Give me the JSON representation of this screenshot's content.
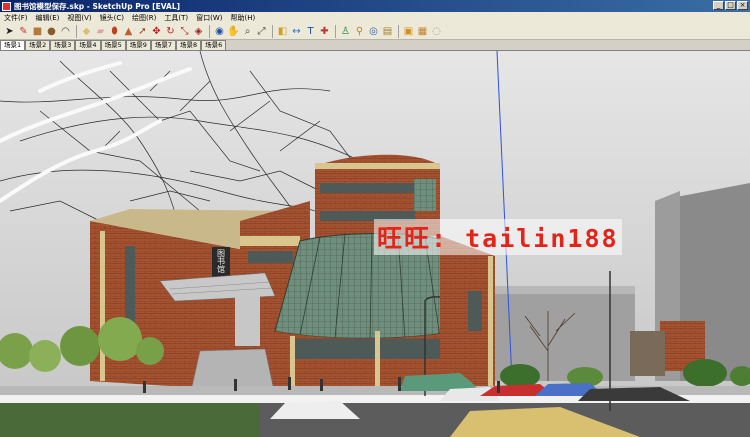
{
  "window": {
    "title": "图书馆模型保存.skp - SketchUp Pro [EVAL]"
  },
  "menu": [
    "文件(F)",
    "编辑(E)",
    "视图(V)",
    "镜头(C)",
    "绘图(R)",
    "工具(T)",
    "窗口(W)",
    "帮助(H)"
  ],
  "toolbar": {
    "tools": [
      {
        "name": "select-icon",
        "color": "#222"
      },
      {
        "name": "pencil-icon",
        "color": "#c0392b"
      },
      {
        "name": "rectangle-icon",
        "color": "#b07a3a"
      },
      {
        "name": "circle-icon",
        "color": "#8a5a2a"
      },
      {
        "name": "arc-icon",
        "color": "#444"
      },
      {
        "name": "sep"
      },
      {
        "name": "make-component-icon",
        "color": "#d8c070"
      },
      {
        "name": "eraser-icon",
        "color": "#e8a0b0"
      },
      {
        "name": "paint-bucket-icon",
        "color": "#c04020"
      },
      {
        "name": "push-pull-icon",
        "color": "#c06030"
      },
      {
        "name": "follow-me-icon",
        "color": "#a04020"
      },
      {
        "name": "move-icon",
        "color": "#c02020"
      },
      {
        "name": "rotate-icon",
        "color": "#c02020"
      },
      {
        "name": "scale-icon",
        "color": "#c02020"
      },
      {
        "name": "offset-icon",
        "color": "#a02020"
      },
      {
        "name": "sep"
      },
      {
        "name": "orbit-icon",
        "color": "#2050a0"
      },
      {
        "name": "pan-icon",
        "color": "#505050"
      },
      {
        "name": "zoom-icon",
        "color": "#404040"
      },
      {
        "name": "zoom-extents-icon",
        "color": "#404040"
      },
      {
        "name": "sep"
      },
      {
        "name": "tape-measure-icon",
        "color": "#d0a020"
      },
      {
        "name": "dimension-icon",
        "color": "#3070c0"
      },
      {
        "name": "text-icon",
        "color": "#2050a0"
      },
      {
        "name": "axes-icon",
        "color": "#c03030"
      },
      {
        "name": "sep"
      },
      {
        "name": "position-camera-icon",
        "color": "#208040"
      },
      {
        "name": "walk-icon",
        "color": "#c08020"
      },
      {
        "name": "look-around-icon",
        "color": "#3060a0"
      },
      {
        "name": "section-plane-icon",
        "color": "#a08030"
      },
      {
        "name": "sep"
      },
      {
        "name": "get-models-icon",
        "color": "#d09020"
      },
      {
        "name": "share-model-icon",
        "color": "#c08030"
      },
      {
        "name": "extension-icon",
        "color": "#909090"
      }
    ]
  },
  "scenes": [
    "场景1",
    "场景2",
    "场景3",
    "场景4",
    "场景5",
    "场景9",
    "场景7",
    "场景8",
    "场景6"
  ],
  "active_scene": 0,
  "viewport": {
    "watermark": "旺旺: tailin188",
    "building_sign": "图书馆"
  }
}
